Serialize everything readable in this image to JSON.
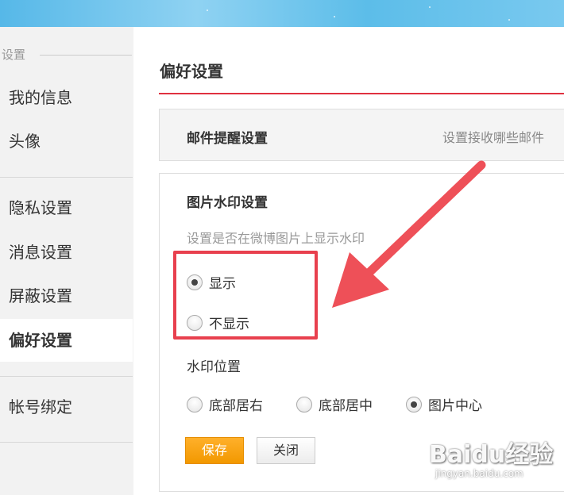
{
  "sidebar": {
    "section_label": "设置",
    "items": [
      {
        "label": "我的信息"
      },
      {
        "label": "头像"
      },
      {
        "label": "隐私设置"
      },
      {
        "label": "消息设置"
      },
      {
        "label": "屏蔽设置"
      },
      {
        "label": "偏好设置",
        "active": true
      },
      {
        "label": "帐号绑定"
      }
    ]
  },
  "main": {
    "title": "偏好设置",
    "mail_panel": {
      "title": "邮件提醒设置",
      "description": "设置接收哪些邮件"
    },
    "watermark_panel": {
      "title": "图片水印设置",
      "description": "设置是否在微博图片上显示水印",
      "display_options": [
        {
          "label": "显示",
          "checked": true
        },
        {
          "label": "不显示",
          "checked": false
        }
      ],
      "position_label": "水印位置",
      "position_options": [
        {
          "label": "底部居右",
          "checked": false
        },
        {
          "label": "底部居中",
          "checked": false
        },
        {
          "label": "图片中心",
          "checked": true
        }
      ],
      "save_label": "保存",
      "close_label": "关闭"
    }
  },
  "colors": {
    "accent_red": "#e0303f",
    "save_orange": "#f29800",
    "annotation_red": "#e8404e"
  },
  "watermark": {
    "logo_text": "Baidu经验",
    "url_text": "jingyan.baidu.com"
  }
}
